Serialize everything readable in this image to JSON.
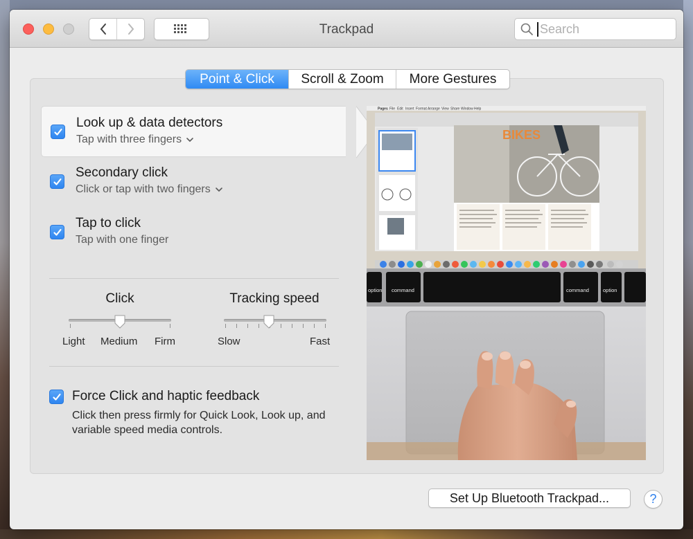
{
  "window": {
    "title": "Trackpad"
  },
  "search": {
    "placeholder": "Search"
  },
  "tabs": [
    {
      "label": "Point & Click",
      "active": true
    },
    {
      "label": "Scroll & Zoom",
      "active": false
    },
    {
      "label": "More Gestures",
      "active": false
    }
  ],
  "options": [
    {
      "title": "Look up & data detectors",
      "subtitle": "Tap with three fingers",
      "checked": true,
      "has_menu": true,
      "selected": true
    },
    {
      "title": "Secondary click",
      "subtitle": "Click or tap with two fingers",
      "checked": true,
      "has_menu": true,
      "selected": false
    },
    {
      "title": "Tap to click",
      "subtitle": "Tap with one finger",
      "checked": true,
      "has_menu": false,
      "selected": false
    }
  ],
  "click_slider": {
    "title": "Click",
    "labels": [
      "Light",
      "Medium",
      "Firm"
    ],
    "value": "Medium"
  },
  "tracking_slider": {
    "title": "Tracking speed",
    "min_label": "Slow",
    "max_label": "Fast",
    "value_fraction": 0.44
  },
  "force_click": {
    "title": "Force Click and haptic feedback",
    "description": "Click then press firmly for Quick Look, Look up, and variable speed media controls.",
    "checked": true
  },
  "preview": {
    "app_menu": [
      "Pages",
      "File",
      "Edit",
      "Insert",
      "Format",
      "Arrange",
      "View",
      "Share",
      "Window",
      "Help"
    ],
    "doc_title": "BIKES",
    "keys": [
      "option",
      "command",
      "command",
      "option"
    ]
  },
  "footer": {
    "bluetooth_button": "Set Up Bluetooth Trackpad...",
    "help": "?"
  },
  "colors": {
    "accent": "#2f8af3",
    "close": "#fc605c",
    "minimize": "#fdbc40"
  }
}
